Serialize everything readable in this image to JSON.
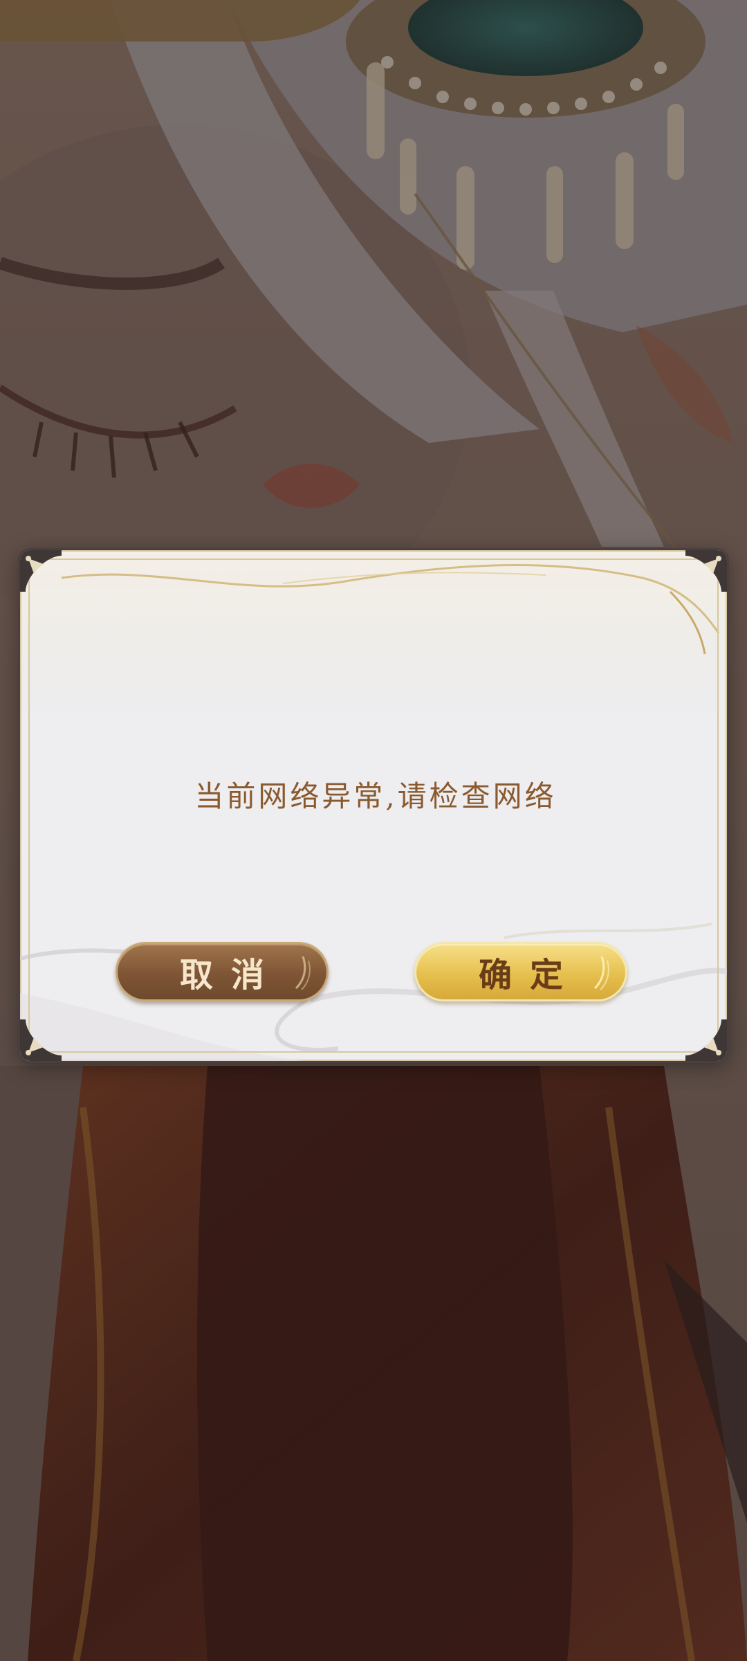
{
  "dialog": {
    "message": "当前网络异常,请检查网络",
    "cancel_label": "取消",
    "confirm_label": "确定"
  },
  "colors": {
    "message_text": "#8a5a2e",
    "cancel_button": "#7e5535",
    "confirm_button": "#e6c04e",
    "dialog_frame": "#4a3f3c",
    "gold_trim": "#d9c79c"
  },
  "icons": {
    "corner": "corner-ornament-icon",
    "glint": "button-glint-icon"
  }
}
